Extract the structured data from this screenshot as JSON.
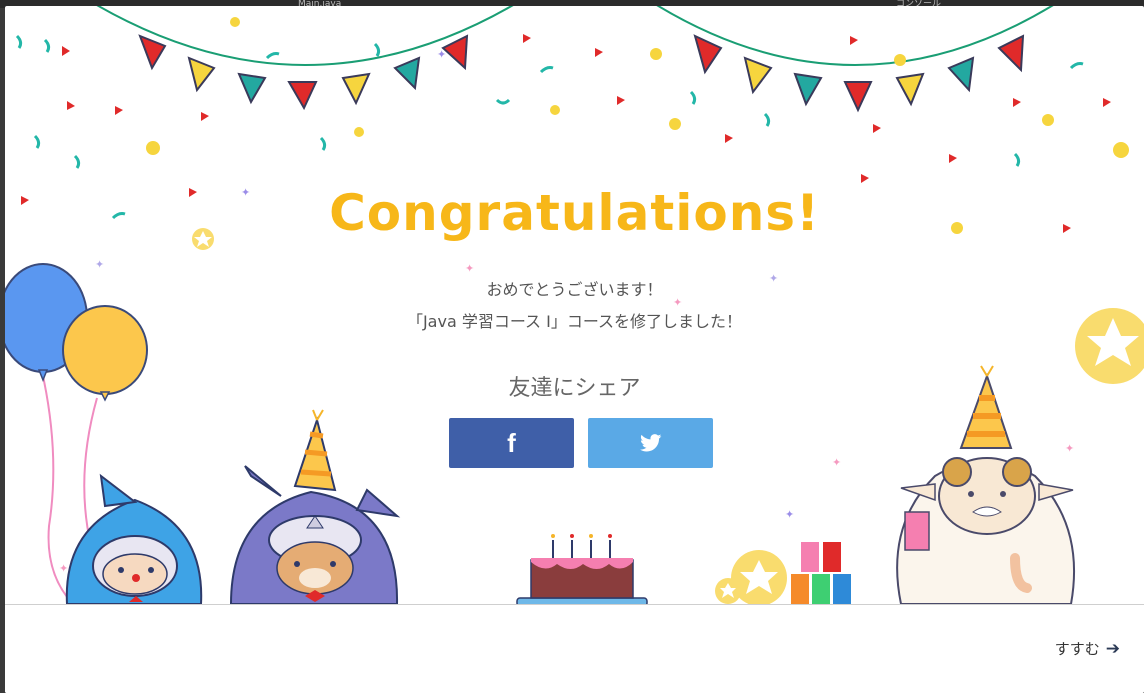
{
  "background_app": {
    "tab": "Main.java",
    "side_text": "コンソール"
  },
  "modal": {
    "title": "Congratulations!",
    "message_line1": "おめでとうございます！",
    "message_line2": "「Java 学習コース I」コースを修了しました！",
    "share_title": "友達にシェア",
    "share_buttons": [
      {
        "name": "facebook",
        "icon": "facebook-icon",
        "glyph": "f",
        "color": "#3f5fa8"
      },
      {
        "name": "twitter",
        "icon": "twitter-bird-icon",
        "color": "#5aa9e6"
      }
    ],
    "next_label": "すすむ",
    "next_icon": "arrow-right-icon"
  },
  "colors": {
    "title": "#f7b719",
    "garland_string": "#1a9e74",
    "flag_red": "#e02a2a",
    "flag_yellow": "#f6d53e",
    "flag_teal": "#23a8a0"
  }
}
